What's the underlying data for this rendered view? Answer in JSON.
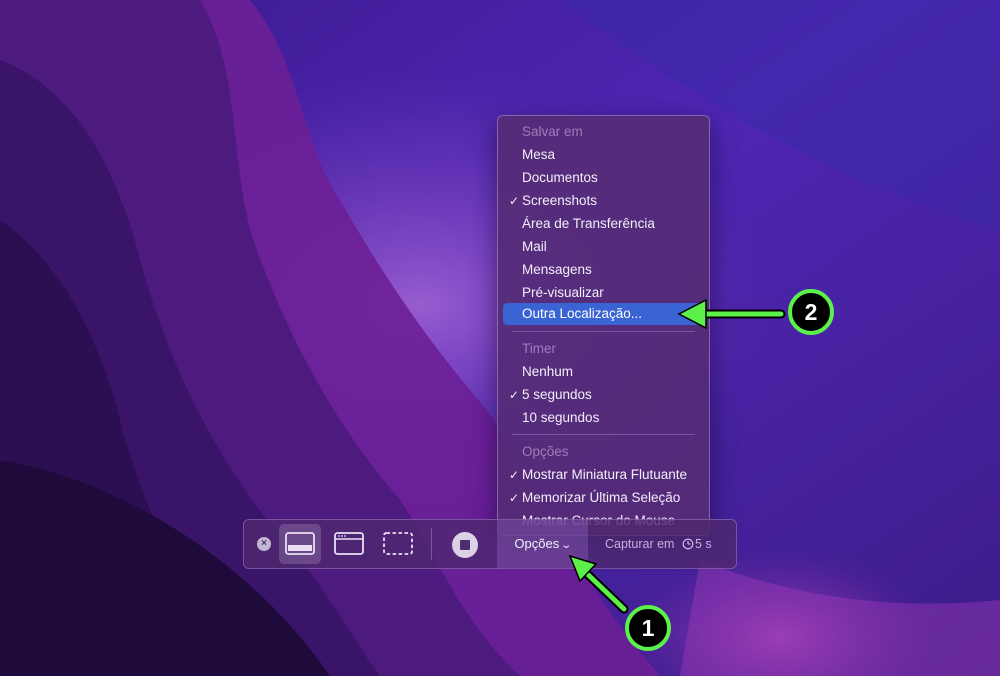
{
  "menu": {
    "save_header": "Salvar em",
    "save_items": [
      {
        "label": "Mesa",
        "checked": false
      },
      {
        "label": "Documentos",
        "checked": false
      },
      {
        "label": "Screenshots",
        "checked": true
      },
      {
        "label": "Área de Transferência",
        "checked": false
      },
      {
        "label": "Mail",
        "checked": false
      },
      {
        "label": "Mensagens",
        "checked": false
      },
      {
        "label": "Pré-visualizar",
        "checked": false
      },
      {
        "label": "Outra Localização...",
        "checked": false,
        "highlighted": true
      }
    ],
    "timer_header": "Timer",
    "timer_items": [
      {
        "label": "Nenhum",
        "checked": false
      },
      {
        "label": "5 segundos",
        "checked": true
      },
      {
        "label": "10 segundos",
        "checked": false
      }
    ],
    "options_header": "Opções",
    "options_items": [
      {
        "label": "Mostrar Miniatura Flutuante",
        "checked": true
      },
      {
        "label": "Memorizar Última Seleção",
        "checked": true
      },
      {
        "label": "Mostrar Cursor do Mouse",
        "checked": false
      }
    ],
    "check_glyph": "✓"
  },
  "toolbar": {
    "close_glyph": "×",
    "options_label": "Opções",
    "options_chevron": "⌄",
    "capture_label": "Capturar em",
    "capture_delay": "5 s",
    "modes": [
      "capture-entire-screen-icon",
      "capture-window-icon",
      "capture-selection-icon"
    ],
    "selected_mode": "capture-entire-screen-icon"
  },
  "annotations": {
    "badge_1": "1",
    "badge_2": "2",
    "color": "#5cf04a"
  },
  "colors": {
    "menu_highlight": "#3a63d4",
    "annotation_green": "#5cf04a"
  }
}
